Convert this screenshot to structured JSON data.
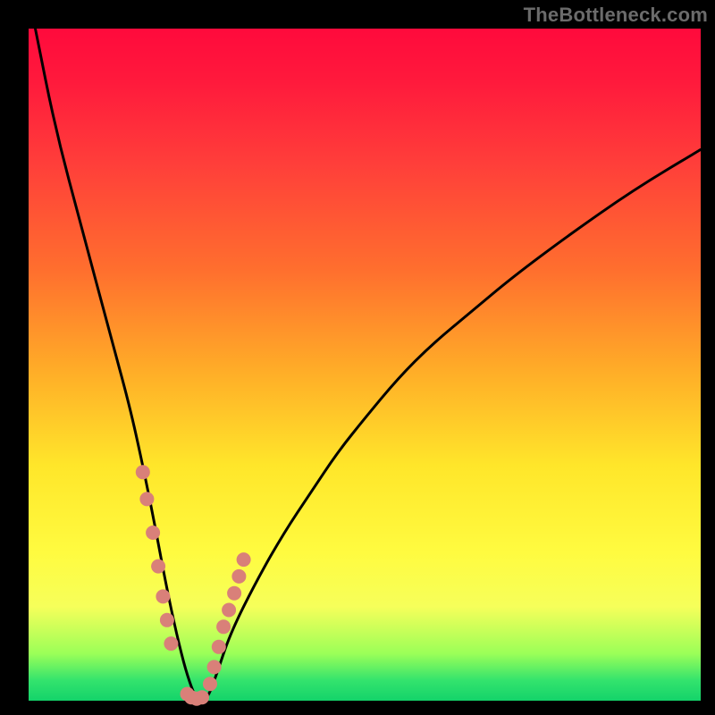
{
  "watermark": "TheBottleneck.com",
  "chart_data": {
    "type": "line",
    "title": "",
    "xlabel": "",
    "ylabel": "",
    "xlim": [
      0,
      100
    ],
    "ylim": [
      0,
      100
    ],
    "series": [
      {
        "name": "bottleneck-curve",
        "x": [
          1,
          4,
          8,
          12,
          15,
          17,
          19,
          20.5,
          22,
          23.5,
          25,
          26.5,
          28,
          30,
          34,
          38,
          42,
          46,
          50,
          55,
          60,
          66,
          72,
          80,
          90,
          100
        ],
        "y": [
          100,
          85,
          70,
          55,
          44,
          35,
          25,
          17,
          10,
          4,
          0,
          0,
          4,
          10,
          18,
          25,
          31,
          37,
          42,
          48,
          53,
          58,
          63,
          69,
          76,
          82
        ]
      }
    ],
    "markers": {
      "name": "highlight-dots",
      "color": "#d98079",
      "x": [
        17.0,
        17.6,
        18.5,
        19.3,
        20.0,
        20.6,
        21.2,
        23.6,
        24.2,
        25.0,
        25.8,
        27.0,
        27.6,
        28.3,
        29.0,
        29.8,
        30.6,
        31.3,
        32.0
      ],
      "y": [
        34.0,
        30.0,
        25.0,
        20.0,
        15.5,
        12.0,
        8.5,
        1.0,
        0.5,
        0.3,
        0.5,
        2.5,
        5.0,
        8.0,
        11.0,
        13.5,
        16.0,
        18.5,
        21.0
      ]
    }
  }
}
